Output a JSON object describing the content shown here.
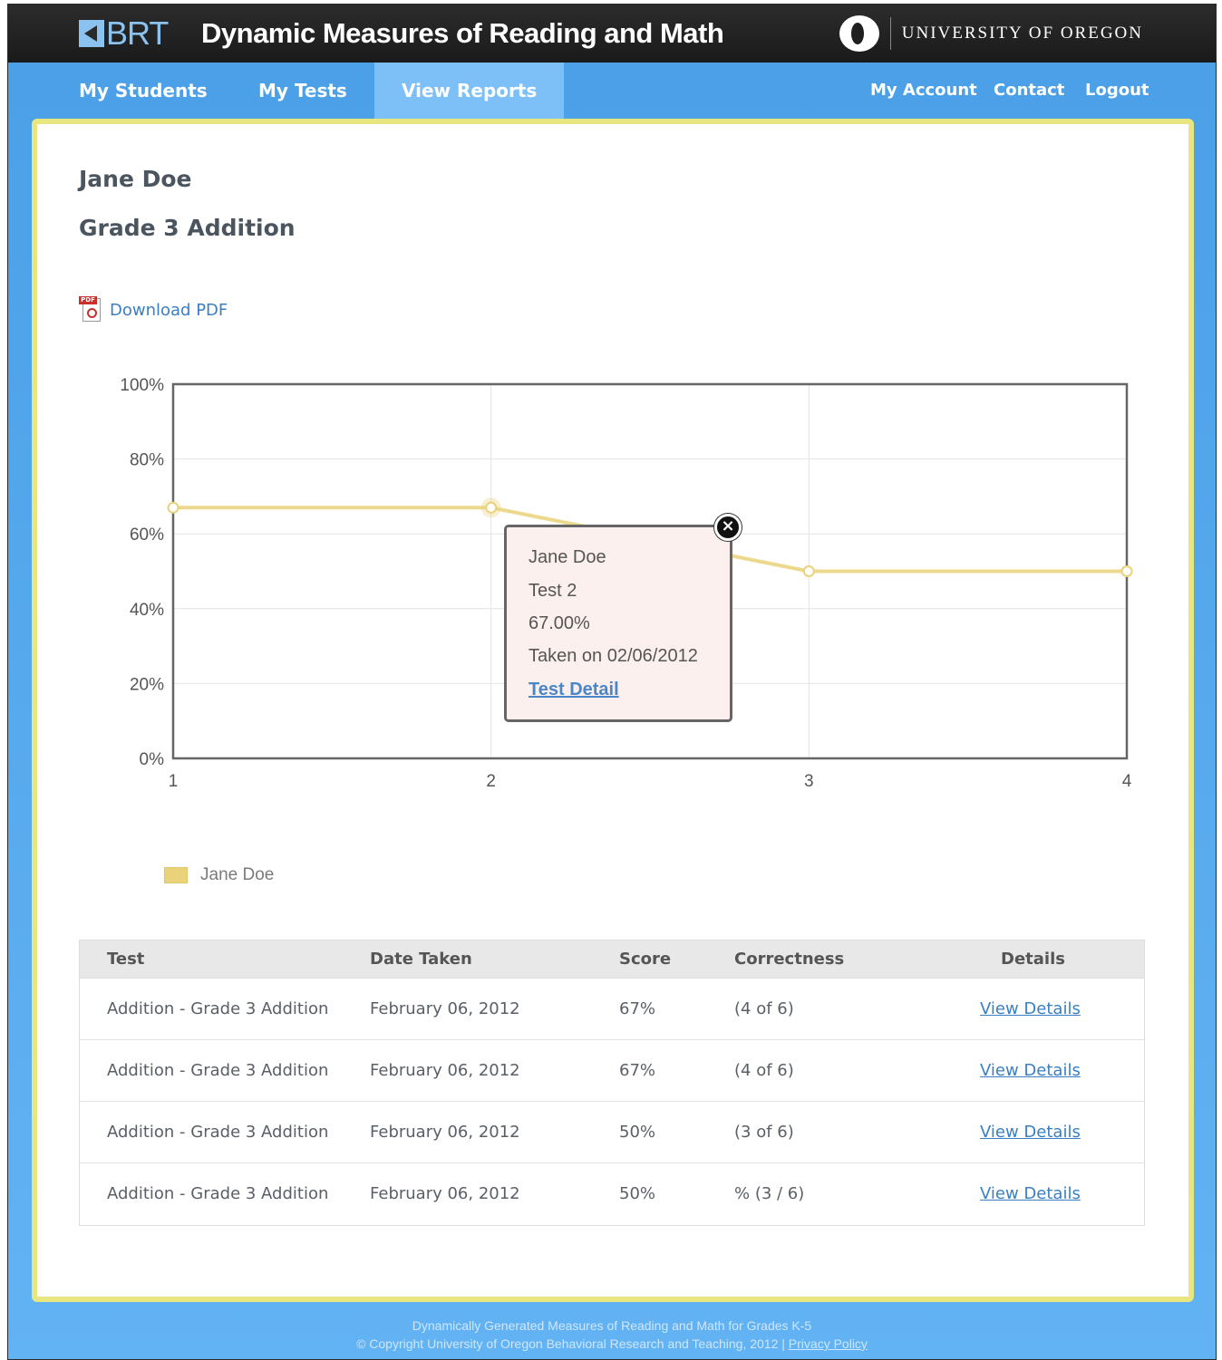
{
  "header": {
    "logo_text": "BRT",
    "title": "Dynamic Measures of Reading and Math",
    "university": "UNIVERSITY OF OREGON"
  },
  "nav": {
    "my_students": "My Students",
    "my_tests": "My Tests",
    "view_reports": "View Reports",
    "my_account": "My Account",
    "contact": "Contact",
    "logout": "Logout"
  },
  "report": {
    "student_name": "Jane Doe",
    "test_name": "Grade 3 Addition",
    "download_label": "Download PDF"
  },
  "chart_data": {
    "type": "line",
    "x": [
      1,
      2,
      3,
      4
    ],
    "series": [
      {
        "name": "Jane Doe",
        "values": [
          67,
          67,
          50,
          50
        ],
        "color": "#e9d27a"
      }
    ],
    "y_ticks": [
      "0%",
      "20%",
      "40%",
      "60%",
      "80%",
      "100%"
    ],
    "x_ticks": [
      "1",
      "2",
      "3",
      "4"
    ],
    "ylim": [
      0,
      100
    ],
    "xlim": [
      1,
      4
    ],
    "grid": true,
    "legend": "bottom-left"
  },
  "tooltip": {
    "name": "Jane Doe",
    "test": "Test 2",
    "score": "67.00%",
    "taken": "Taken on 02/06/2012",
    "link": "Test Detail"
  },
  "table": {
    "headers": {
      "test": "Test",
      "date": "Date Taken",
      "score": "Score",
      "correctness": "Correctness",
      "details": "Details"
    },
    "rows": [
      {
        "test": "Addition - Grade 3 Addition",
        "date": "February 06, 2012",
        "score": "67%",
        "correctness": "(4 of 6)",
        "details": "View Details"
      },
      {
        "test": "Addition - Grade 3 Addition",
        "date": "February 06, 2012",
        "score": "67%",
        "correctness": "(4 of 6)",
        "details": "View Details"
      },
      {
        "test": "Addition - Grade 3 Addition",
        "date": "February 06, 2012",
        "score": "50%",
        "correctness": "(3 of 6)",
        "details": "View Details"
      },
      {
        "test": "Addition - Grade 3 Addition",
        "date": "February 06, 2012",
        "score": "50%",
        "correctness": "% (3 / 6)",
        "details": "View Details"
      }
    ]
  },
  "footer": {
    "line1": "Dynamically Generated Measures of Reading and Math for Grades K-5",
    "line2": "© Copyright University of Oregon Behavioral Research and Teaching, 2012 | ",
    "privacy": "Privacy Policy"
  }
}
